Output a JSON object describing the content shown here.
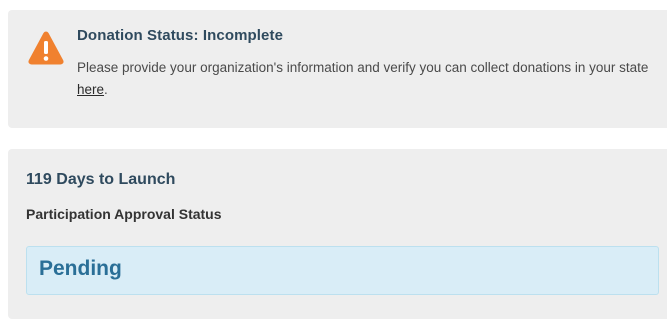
{
  "donation_alert": {
    "icon": "warning-icon",
    "icon_color": "#f0812f",
    "title": "Donation Status: Incomplete",
    "message_before_link": "Please provide your organization's information and verify you can collect donations in your state ",
    "link_text": "here",
    "message_after_link": "."
  },
  "launch_status": {
    "countdown": "119 Days to Launch",
    "approval_label": "Participation Approval Status",
    "approval_value": "Pending",
    "approval_color": "#2a6f97"
  }
}
